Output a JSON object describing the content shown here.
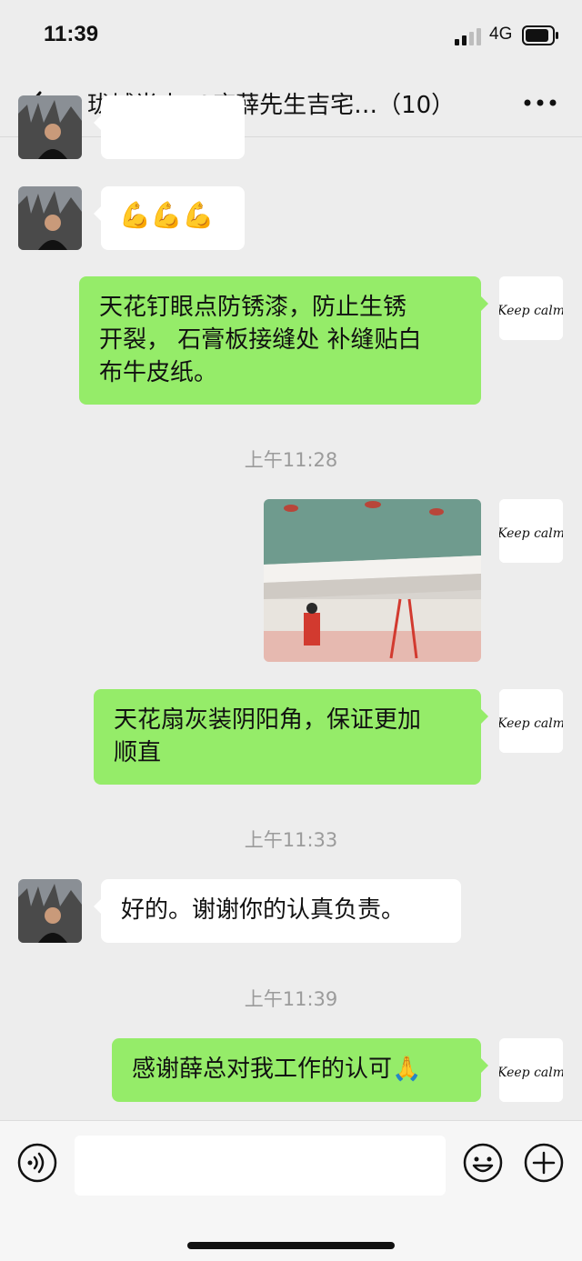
{
  "status": {
    "time": "11:39",
    "network": "4G"
  },
  "nav": {
    "title": "珑城半山50座薛先生吉宅…（10）"
  },
  "messages": [
    {
      "type": "text",
      "side": "left",
      "text": "💪💪💪"
    },
    {
      "type": "text",
      "side": "right",
      "lines": [
        "天花钉眼点防锈漆，防止生锈",
        "开裂， 石膏板接缝处 补缝贴白",
        "布牛皮纸。"
      ]
    },
    {
      "type": "timestamp",
      "text": "上午11:28"
    },
    {
      "type": "image",
      "side": "right"
    },
    {
      "type": "text",
      "side": "right",
      "lines": [
        "天花扇灰装阴阳角，保证更加",
        "顺直"
      ]
    },
    {
      "type": "timestamp",
      "text": "上午11:33"
    },
    {
      "type": "text",
      "side": "left",
      "text": "好的。谢谢你的认真负责。"
    },
    {
      "type": "timestamp",
      "text": "上午11:39"
    },
    {
      "type": "text",
      "side": "right",
      "text": "感谢薛总对我工作的认可🙏"
    }
  ],
  "avatar_right_label": "Keep calm",
  "colors": {
    "background": "#ededed",
    "sent_bubble": "#95ec69",
    "received_bubble": "#ffffff"
  },
  "icons": [
    "back-arrow-icon",
    "more-icon",
    "voice-icon",
    "emoji-icon",
    "plus-icon",
    "signal-icon",
    "battery-icon"
  ]
}
